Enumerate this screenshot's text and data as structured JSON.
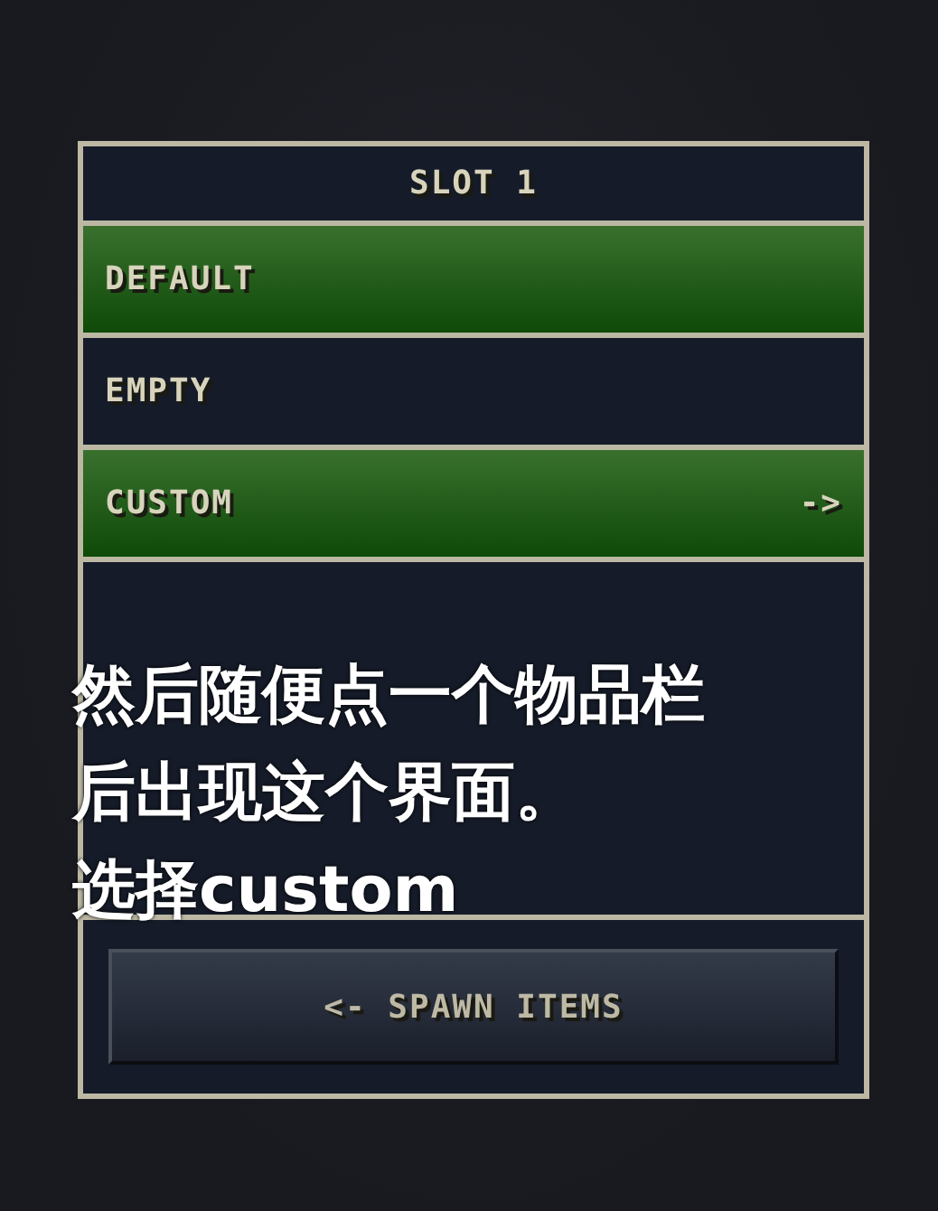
{
  "panel": {
    "title": "SLOT 1",
    "options": [
      {
        "label": "DEFAULT",
        "highlighted": true
      },
      {
        "label": "EMPTY",
        "highlighted": false
      },
      {
        "label": "CUSTOM",
        "highlighted": true,
        "arrow": "->"
      }
    ],
    "button": "<- SPAWN ITEMS"
  },
  "caption": {
    "lines": [
      "然后随便点一个物品栏",
      "后出现这个界面。",
      "选择custom"
    ]
  }
}
